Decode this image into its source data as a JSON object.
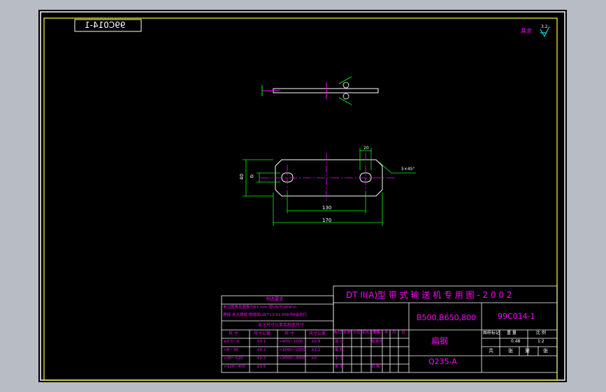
{
  "drawing_code_mirrored": "99C014-1",
  "surface_finish": "其余",
  "surface_value": "3.2",
  "dim_width": "170",
  "dim_hole_spacing": "130",
  "dim_hole_offset": "20",
  "dim_height": "40",
  "dim_chamfer": "5×45°",
  "dim_slot": "Ø",
  "title_block": {
    "title": "DT II(A)型  带 式 输 送 机 专 用 图 - 2 0 0 2",
    "spec": "B500,B650,800",
    "code": "99C014-1",
    "part_name": "扁钢",
    "material": "Q235-A",
    "stage_label": "图样标记",
    "weight_label": "重  量",
    "scale_label": "比  例",
    "weight_value": "0.48",
    "scale_value": "1:2",
    "sheet_a": "共",
    "sheet_b": "张",
    "sheet_c": "第",
    "sheet_d": "张"
  },
  "tech_block": {
    "header": "制造要求",
    "line1": "未注圆角及圆角为R1 mm 按GB/T1804-m",
    "line2": "焊接 未注焊缝 焊缝按GB/T13-61.856中8级执行",
    "table_header": "未注尺寸公差及制造尺寸",
    "col1": "尺 寸",
    "col2": "尺寸公差",
    "col3": "尺 寸",
    "col4": "尺寸公差",
    "rows": [
      [
        "≥0.5～6",
        "±0.1",
        ">400～1000",
        "±0.8"
      ],
      [
        ">6～30",
        "±0.2",
        ">1000～2000",
        "±1.2"
      ],
      [
        ">30～120",
        "±0.3",
        ">2000～4000",
        "±2"
      ],
      [
        ">120～400",
        "±0.5",
        "",
        ""
      ]
    ]
  },
  "sign_block": {
    "c1": "标记",
    "c2": "处数",
    "c3": "分区",
    "c4": "更改文件号",
    "c5": "签名",
    "c6": "年",
    "c7": "月",
    "c8": "日",
    "r1": "设 计",
    "r1b": "标准化",
    "r2": "审 核",
    "r3": "工 艺",
    "r4": "批 准",
    "r4b": "日 期"
  }
}
